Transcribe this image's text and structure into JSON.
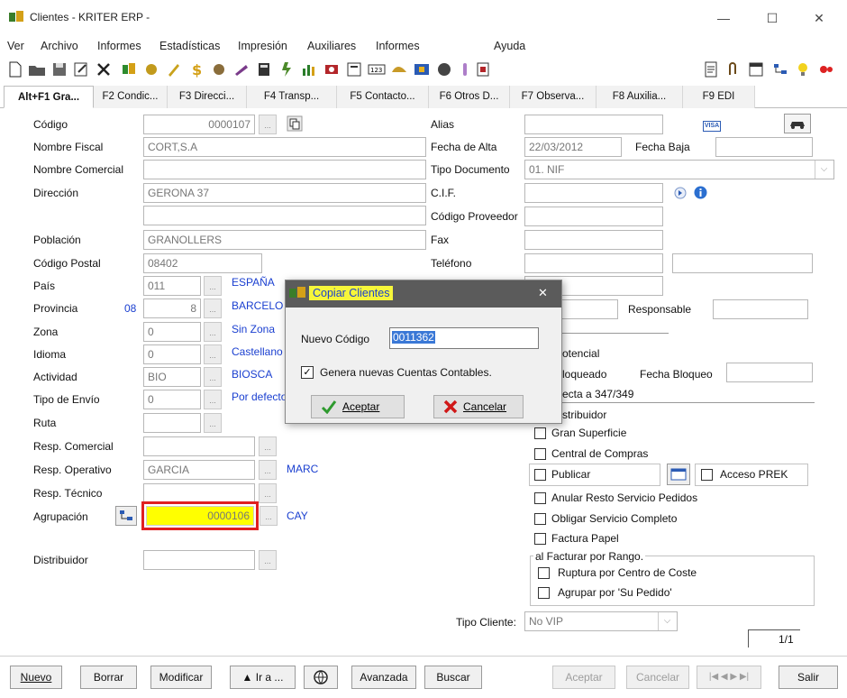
{
  "window": {
    "title": "Clientes - KRITER ERP -",
    "minimize": "—",
    "maximize": "☐",
    "close": "✕"
  },
  "menu": [
    "Ver",
    "Archivo",
    "Informes",
    "Estadísticas",
    "Impresión",
    "Auxiliares",
    "Informes",
    "Ayuda"
  ],
  "tabs": [
    "Alt+F1 Gra...",
    "F2 Condic...",
    "F3 Direcci...",
    "F4 Transp...",
    "F5 Contacto...",
    "F6 Otros D...",
    "F7 Observa...",
    "F8 Auxilia...",
    "F9 EDI"
  ],
  "left": {
    "codigo": {
      "label": "Código",
      "value": "0000107"
    },
    "nombre_fiscal": {
      "label": "Nombre Fiscal",
      "value": "CORT,S.A"
    },
    "nombre_comercial": {
      "label": "Nombre Comercial",
      "value": ""
    },
    "direccion": {
      "label": "Dirección",
      "value": "GERONA 37",
      "value2": ""
    },
    "poblacion": {
      "label": "Población",
      "value": "GRANOLLERS"
    },
    "codigo_postal": {
      "label": "Código Postal",
      "value": "08402"
    },
    "pais": {
      "label": "País",
      "value": "011",
      "desc": "ESPAÑA"
    },
    "provincia": {
      "label": "Provincia",
      "prefix": "08",
      "value": "8",
      "desc": "BARCELO"
    },
    "zona": {
      "label": "Zona",
      "value": "0",
      "desc": "Sin Zona"
    },
    "idioma": {
      "label": "Idioma",
      "value": "0",
      "desc": "Castellano"
    },
    "actividad": {
      "label": "Actividad",
      "value": "BIO",
      "desc": "BIOSCA"
    },
    "tipo_envio": {
      "label": "Tipo de Envío",
      "value": "0",
      "desc": "Por defecto"
    },
    "ruta": {
      "label": "Ruta",
      "value": ""
    },
    "resp_comercial": {
      "label": "Resp. Comercial",
      "value": ""
    },
    "resp_operativo": {
      "label": "Resp. Operativo",
      "value": "GARCIA",
      "desc": "MARC"
    },
    "resp_tecnico": {
      "label": "Resp. Técnico",
      "value": ""
    },
    "agrupacion": {
      "label": "Agrupación",
      "value": "0000106",
      "desc": "CAY"
    },
    "distribuidor": {
      "label": "Distribuidor",
      "value": ""
    }
  },
  "right": {
    "alias": {
      "label": "Alias",
      "value": ""
    },
    "fecha_alta": {
      "label": "Fecha de Alta",
      "value": "22/03/2012"
    },
    "fecha_baja": {
      "label": "Fecha Baja",
      "value": ""
    },
    "tipo_documento": {
      "label": "Tipo Documento",
      "value": "01. NIF"
    },
    "cif": {
      "label": "C.I.F.",
      "value": ""
    },
    "codigo_proveedor": {
      "label": "Código Proveedor",
      "value": ""
    },
    "fax": {
      "label": "Fax",
      "value": ""
    },
    "telefono": {
      "label": "Teléfono",
      "value": ""
    },
    "responsable": {
      "label": "Responsable",
      "value": ""
    },
    "potencial": "otencial",
    "bloqueado": "loqueado",
    "fecha_bloqueo": {
      "label": "Fecha Bloqueo",
      "value": ""
    },
    "afecta": "ecta a 347/349",
    "distribuidor_chk": "stribuidor",
    "gran_superficie": "Gran Superficie",
    "central_compras": "Central de Compras",
    "publicar": "Publicar",
    "acceso_prek": "Acceso PREK",
    "anular_resto": "Anular Resto Servicio Pedidos",
    "obligar_servicio": "Obligar Servicio Completo",
    "factura_papel": "Factura Papel",
    "group_title": "al Facturar por Rango.",
    "ruptura": "Ruptura por Centro de Coste",
    "agrupar_pedido": "Agrupar por 'Su Pedido'",
    "tipo_cliente": {
      "label": "Tipo Cliente:",
      "value": "No VIP"
    },
    "pager": "1/1",
    "visa": "VISA"
  },
  "dialog": {
    "title": "Copiar Clientes",
    "close": "✕",
    "nuevo_codigo_label": "Nuevo Código",
    "nuevo_codigo_value": "0011362",
    "genera_label": "Genera nuevas Cuentas Contables.",
    "aceptar": "Aceptar",
    "cancelar": "Cancelar"
  },
  "bottom": {
    "nuevo": "Nuevo",
    "borrar": "Borrar",
    "modificar": "Modificar",
    "ir_a": "▲ Ir a ...",
    "avanzada": "Avanzada",
    "buscar": "Buscar",
    "aceptar": "Aceptar",
    "cancelar": "Cancelar",
    "nav": "|◀ ◀ ▶ ▶|",
    "salir": "Salir"
  },
  "colors": {
    "highlight": "#ffff00",
    "highlight_border": "#e02020",
    "link_blue": "#1a3fd0",
    "dialog_title": "#5b5b5b"
  }
}
